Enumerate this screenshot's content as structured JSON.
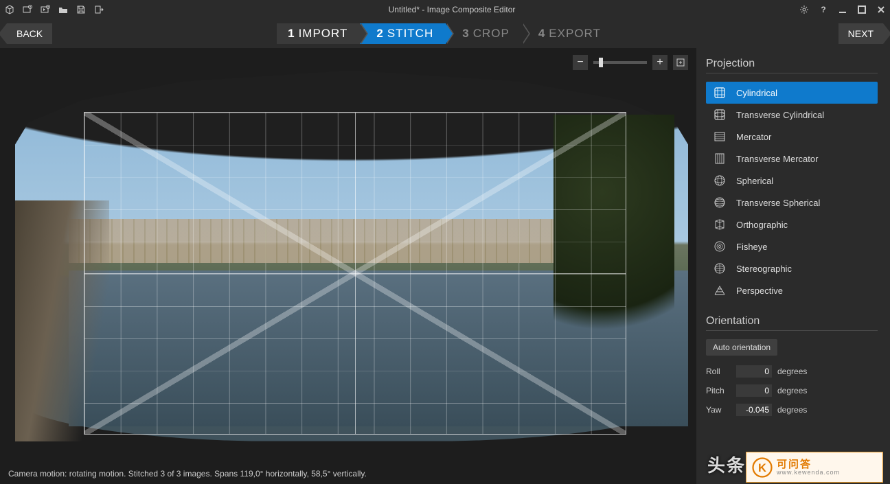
{
  "title": "Untitled* - Image Composite Editor",
  "nav": {
    "back": "BACK",
    "next": "NEXT"
  },
  "steps": [
    {
      "num": "1",
      "label": "IMPORT",
      "state": "done"
    },
    {
      "num": "2",
      "label": "STITCH",
      "state": "active"
    },
    {
      "num": "3",
      "label": "CROP",
      "state": ""
    },
    {
      "num": "4",
      "label": "EXPORT",
      "state": ""
    }
  ],
  "projection": {
    "title": "Projection",
    "items": [
      {
        "label": "Cylindrical",
        "selected": true
      },
      {
        "label": "Transverse Cylindrical"
      },
      {
        "label": "Mercator"
      },
      {
        "label": "Transverse Mercator"
      },
      {
        "label": "Spherical"
      },
      {
        "label": "Transverse Spherical"
      },
      {
        "label": "Orthographic"
      },
      {
        "label": "Fisheye"
      },
      {
        "label": "Stereographic"
      },
      {
        "label": "Perspective"
      }
    ]
  },
  "orientation": {
    "title": "Orientation",
    "auto": "Auto orientation",
    "roll_label": "Roll",
    "roll_value": "0",
    "roll_unit": "degrees",
    "pitch_label": "Pitch",
    "pitch_value": "0",
    "pitch_unit": "degrees",
    "yaw_label": "Yaw",
    "yaw_value": "-0.045",
    "yaw_unit": "degrees"
  },
  "status": "Camera motion: rotating motion. Stitched 3 of 3 images. Spans 119,0° horizontally,  58,5° vertically.",
  "overlay": "头条",
  "watermark": {
    "brand": "可问答",
    "url": "www.kewenda.com"
  }
}
